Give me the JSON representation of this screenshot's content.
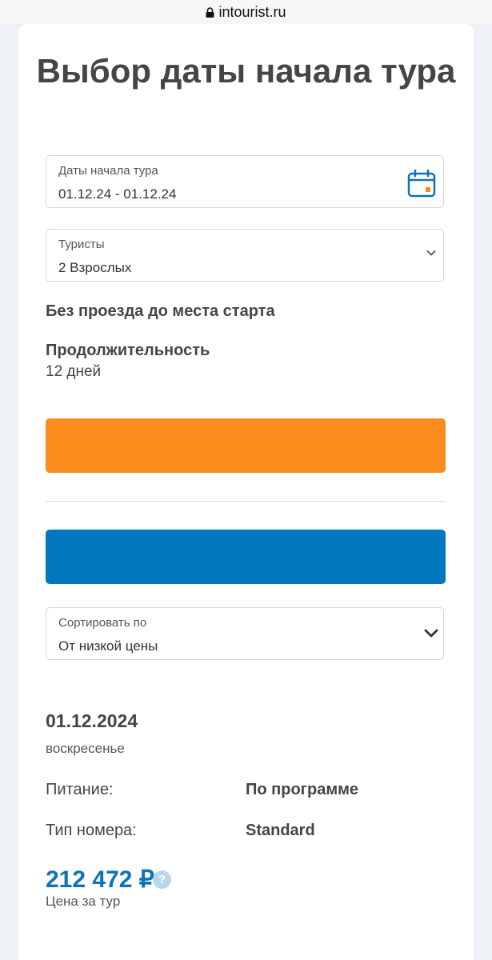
{
  "browser": {
    "url": "intourist.ru"
  },
  "page": {
    "title": "Выбор даты начала тура"
  },
  "date_field": {
    "label": "Даты начала тура",
    "value": "01.12.24 - 01.12.24",
    "icon": "calendar-icon"
  },
  "tourists_field": {
    "label": "Туристы",
    "value": "2 Взрослых",
    "icon": "chevron-down-icon"
  },
  "transfer_note": "Без проезда до места старта",
  "duration": {
    "label": "Продолжительность",
    "value": "12 дней"
  },
  "buttons": {
    "primary_color": "#fb8c1e",
    "secondary_color": "#0377c0"
  },
  "sort_field": {
    "label": "Сортировать по",
    "value": "От низкой цены",
    "icon": "chevron-down-icon"
  },
  "tour": {
    "date": "01.12.2024",
    "weekday": "воскресенье",
    "food_label": "Питание:",
    "food_value": "По программе",
    "room_label": "Тип номера:",
    "room_value": "Standard",
    "price": "212 472 ₽",
    "price_help": "?",
    "price_caption": "Цена за тур"
  }
}
